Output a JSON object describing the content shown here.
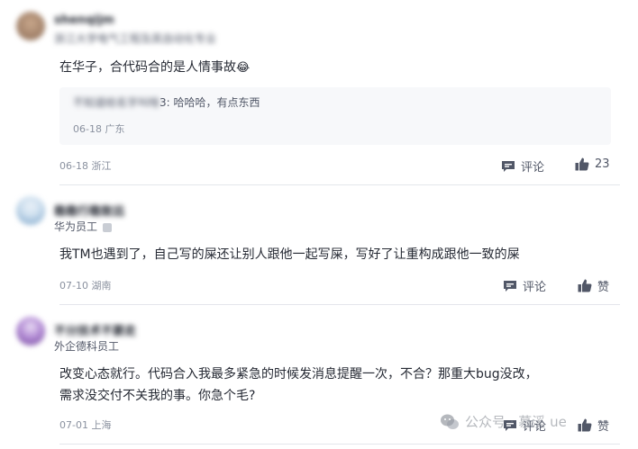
{
  "comments": [
    {
      "username": "shenqijm",
      "subtitle": "浙江大学电气工程及其自动化专业",
      "content": "在华子，合代码合的是人情事故",
      "emoji": "😂",
      "reply": {
        "author": "不知道给名字叫啥",
        "number": "3",
        "text": "哈哈哈，有点东西",
        "date": "06-18",
        "location": "广东"
      },
      "date": "06-18",
      "location": "浙江",
      "comment_label": "评论",
      "like_count": "23"
    },
    {
      "username": "稳稳行稳致远",
      "subtitle": "华为员工",
      "content": "我TM也遇到了，自己写的屎还让别人跟他一起写屎，写好了让重构成跟他一致的屎",
      "date": "07-10",
      "location": "湖南",
      "comment_label": "评论",
      "like_label": "赞"
    },
    {
      "username": "不分技术不要走",
      "subtitle": "外企德科员工",
      "content_line1": "改变心态就行。代码合入我最多紧急的时候发消息提醒一次，不合？那重大bug没改，",
      "content_line2": "需求没交付不关我的事。你急个毛?",
      "date": "07-01",
      "location": "上海",
      "comment_label": "评论",
      "like_label": "赞"
    }
  ],
  "watermark": "公众号 · 慕溪 ue"
}
